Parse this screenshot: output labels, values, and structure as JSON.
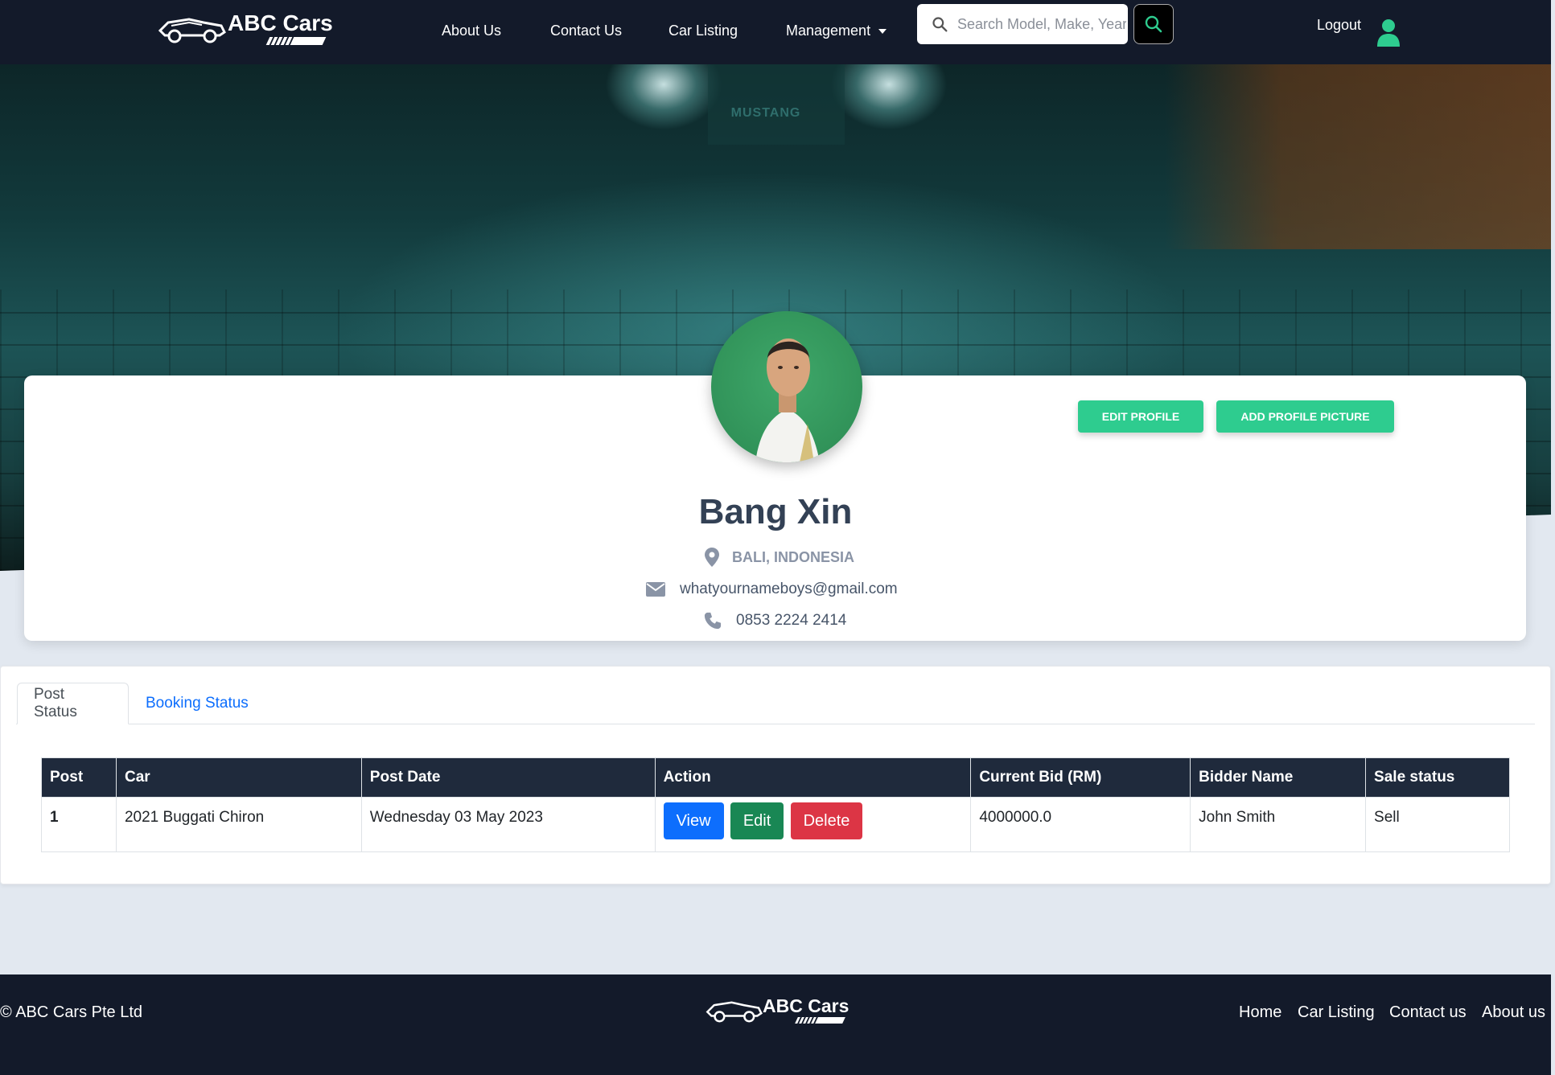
{
  "nav": {
    "brand": "ABC Cars",
    "links": [
      "About Us",
      "Contact Us",
      "Car Listing",
      "Management"
    ],
    "search_placeholder": "Search Model, Make, Year",
    "logout": "Logout"
  },
  "hero": {
    "sign": "MUSTANG"
  },
  "profile": {
    "name": "Bang Xin",
    "location": "BALI, INDONESIA",
    "email": "whatyournameboys@gmail.com",
    "phone": "0853 2224 2414",
    "edit_button": "EDIT PROFILE",
    "add_picture_button": "ADD PROFILE PICTURE"
  },
  "tabs": [
    "Post Status",
    "Booking Status"
  ],
  "table": {
    "headers": [
      "Post",
      "Car",
      "Post Date",
      "Action",
      "Current Bid (RM)",
      "Bidder Name",
      "Sale status"
    ],
    "rows": [
      {
        "post": "1",
        "car": "2021 Buggati Chiron",
        "post_date": "Wednesday 03 May 2023",
        "actions": [
          "View",
          "Edit",
          "Delete"
        ],
        "current_bid": "4000000.0",
        "bidder_name": "John Smith",
        "sale_status": "Sell"
      }
    ]
  },
  "footer": {
    "copyright": "© ABC Cars Pte Ltd",
    "brand": "ABC Cars",
    "links": [
      "Home",
      "Car Listing",
      "Contact us",
      "About us"
    ]
  },
  "colors": {
    "navbar": "#131a2a",
    "accent": "#2ecc8f",
    "view": "#0d6efd",
    "edit": "#198754",
    "delete": "#dc3545",
    "table_header": "#1f2a3c"
  }
}
